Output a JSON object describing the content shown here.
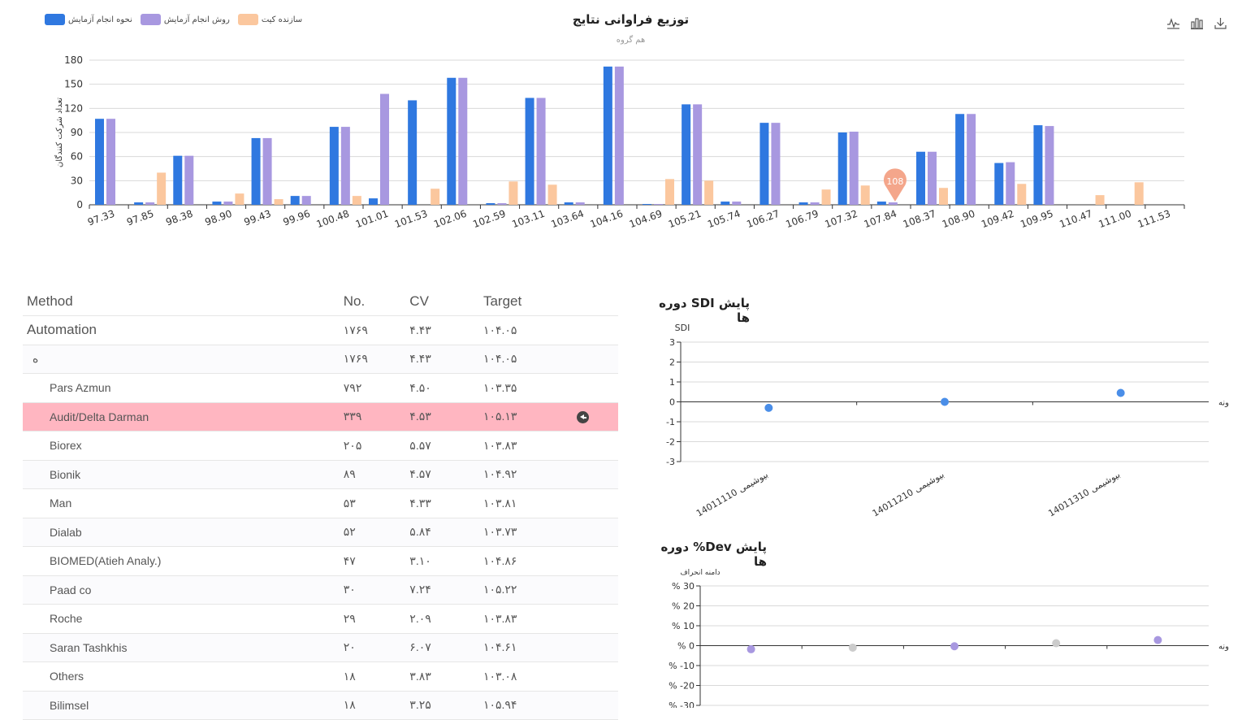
{
  "toolbar": {
    "icons": [
      "line-chart-icon",
      "bar-chart-icon",
      "download-icon"
    ]
  },
  "colors": {
    "blue": "#2f78e0",
    "purple": "#a898e0",
    "orange": "#fbc79e",
    "highlight": "#ffb6c1",
    "marker": "#f4a68b"
  },
  "legend": [
    {
      "label": "نحوه انجام آزمایش",
      "color": "#2f78e0"
    },
    {
      "label": "روش انجام آزمایش",
      "color": "#a898e0"
    },
    {
      "label": "سازنده کیت",
      "color": "#fbc79e"
    }
  ],
  "marker": {
    "label": "108",
    "category": "107.84"
  },
  "chart_data": [
    {
      "type": "bar",
      "title": "توزیع فراوانی نتایج",
      "subtitle": "هم گروه",
      "ylabel": "تعداد شرکت کنندگان",
      "ylim": [
        0,
        180
      ],
      "yticks": [
        0,
        30,
        60,
        90,
        120,
        150,
        180
      ],
      "categories": [
        "97.33",
        "97.85",
        "98.38",
        "98.90",
        "99.43",
        "99.96",
        "100.48",
        "101.01",
        "101.53",
        "102.06",
        "102.59",
        "103.11",
        "103.64",
        "104.16",
        "104.69",
        "105.21",
        "105.74",
        "106.27",
        "106.79",
        "107.32",
        "107.84",
        "108.37",
        "108.90",
        "109.42",
        "109.95",
        "110.47",
        "111.00",
        "111.53"
      ],
      "series": [
        {
          "name": "نحوه انجام آزمایش",
          "values": [
            107,
            3,
            61,
            4,
            83,
            11,
            97,
            8,
            130,
            158,
            2,
            133,
            3,
            172,
            1,
            125,
            4,
            102,
            3,
            90,
            4,
            66,
            113,
            52,
            99,
            0,
            0,
            0
          ]
        },
        {
          "name": "روش انجام آزمایش",
          "values": [
            107,
            3,
            61,
            4,
            83,
            11,
            97,
            138,
            0,
            158,
            2,
            133,
            3,
            172,
            1,
            125,
            4,
            102,
            3,
            91,
            3,
            66,
            113,
            53,
            98,
            0,
            0,
            0
          ]
        },
        {
          "name": "سازنده کیت",
          "values": [
            0,
            40,
            0,
            14,
            7,
            0,
            11,
            0,
            20,
            0,
            29,
            25,
            0,
            0,
            32,
            30,
            0,
            0,
            19,
            24,
            0,
            21,
            0,
            26,
            0,
            12,
            28,
            0
          ]
        }
      ]
    },
    {
      "type": "scatter",
      "title": "پایش SDI دوره ها",
      "ylabel": "SDI",
      "ylim": [
        -3,
        3
      ],
      "yticks": [
        "3",
        "2",
        "1",
        "0",
        "-1",
        "-2",
        "-3"
      ],
      "side_label": "ونه",
      "categories": [
        "14011110 بیوشیمی",
        "14011210 بیوشیمی",
        "14011310 بیوشیمی"
      ],
      "values": [
        -0.3,
        0.0,
        0.45
      ]
    },
    {
      "type": "scatter",
      "title": "پایش Dev% دوره ها",
      "ylabel": "دامنه انحراف",
      "ylim": [
        -30,
        30
      ],
      "yticks": [
        "% 30",
        "% 20",
        "% 10",
        "% 0",
        "% -10",
        "% -20",
        "% -30"
      ],
      "side_label": "ونه",
      "values": [
        -1.8,
        -1.0,
        -0.3,
        1.2,
        2.8
      ],
      "colors": [
        "#a898e0",
        "#cccccc",
        "#a898e0",
        "#cccccc",
        "#a898e0"
      ]
    }
  ],
  "table": {
    "headers": {
      "method": "Method",
      "no": "No.",
      "cv": "CV",
      "target": "Target"
    },
    "rows": [
      {
        "method": "Automation",
        "no": "۱۷۶۹",
        "cv": "۴.۴۳",
        "target": "۱۰۴.۰۵",
        "kind": "group"
      },
      {
        "method": "ه",
        "no": "۱۷۶۹",
        "cv": "۴.۴۳",
        "target": "۱۰۴.۰۵",
        "kind": "zero"
      },
      {
        "method": "Pars Azmun",
        "no": "۷۹۲",
        "cv": "۴.۵۰",
        "target": "۱۰۳.۳۵",
        "kind": "sub"
      },
      {
        "method": "Audit/Delta Darman",
        "no": "۳۳۹",
        "cv": "۴.۵۳",
        "target": "۱۰۵.۱۳",
        "kind": "highlight"
      },
      {
        "method": "Biorex",
        "no": "۲۰۵",
        "cv": "۵.۵۷",
        "target": "۱۰۳.۸۳",
        "kind": "sub"
      },
      {
        "method": "Bionik",
        "no": "۸۹",
        "cv": "۴.۵۷",
        "target": "۱۰۴.۹۲",
        "kind": "sub"
      },
      {
        "method": "Man",
        "no": "۵۳",
        "cv": "۴.۳۳",
        "target": "۱۰۳.۸۱",
        "kind": "sub"
      },
      {
        "method": "Dialab",
        "no": "۵۲",
        "cv": "۵.۸۴",
        "target": "۱۰۳.۷۳",
        "kind": "sub"
      },
      {
        "method": "BIOMED(Atieh Analy.)",
        "no": "۴۷",
        "cv": "۳.۱۰",
        "target": "۱۰۴.۸۶",
        "kind": "sub"
      },
      {
        "method": "Paad co",
        "no": "۳۰",
        "cv": "۷.۲۴",
        "target": "۱۰۵.۲۲",
        "kind": "sub"
      },
      {
        "method": "Roche",
        "no": "۲۹",
        "cv": "۲.۰۹",
        "target": "۱۰۳.۸۳",
        "kind": "sub"
      },
      {
        "method": "Saran Tashkhis",
        "no": "۲۰",
        "cv": "۶.۰۷",
        "target": "۱۰۴.۶۱",
        "kind": "sub"
      },
      {
        "method": "Others",
        "no": "۱۸",
        "cv": "۳.۸۳",
        "target": "۱۰۳.۰۸",
        "kind": "sub"
      },
      {
        "method": "Bilimsel",
        "no": "۱۸",
        "cv": "۳.۲۵",
        "target": "۱۰۵.۹۴",
        "kind": "sub"
      }
    ]
  }
}
